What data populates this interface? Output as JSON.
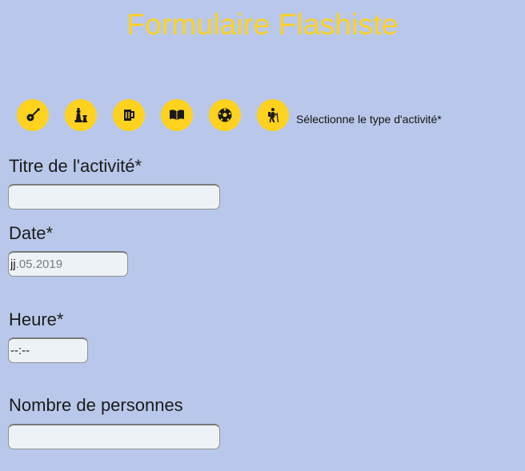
{
  "page": {
    "title": "Formulaire Flashiste",
    "accent_color": "#ffd21f",
    "background_color": "#b9c8ea"
  },
  "activity_types": {
    "hint": "Sélectionne le type d'activité*",
    "icons": [
      {
        "name": "guitar-icon"
      },
      {
        "name": "chess-icon"
      },
      {
        "name": "beer-icon"
      },
      {
        "name": "book-icon"
      },
      {
        "name": "soccer-ball-icon"
      },
      {
        "name": "hiking-icon"
      }
    ]
  },
  "fields": {
    "title": {
      "label": "Titre de l'activité*",
      "value": ""
    },
    "date": {
      "label": "Date*",
      "value_day": "jj",
      "value_rest": ".05.2019"
    },
    "time": {
      "label": "Heure*",
      "value": "--:--"
    },
    "people": {
      "label": "Nombre de personnes",
      "value": ""
    }
  }
}
